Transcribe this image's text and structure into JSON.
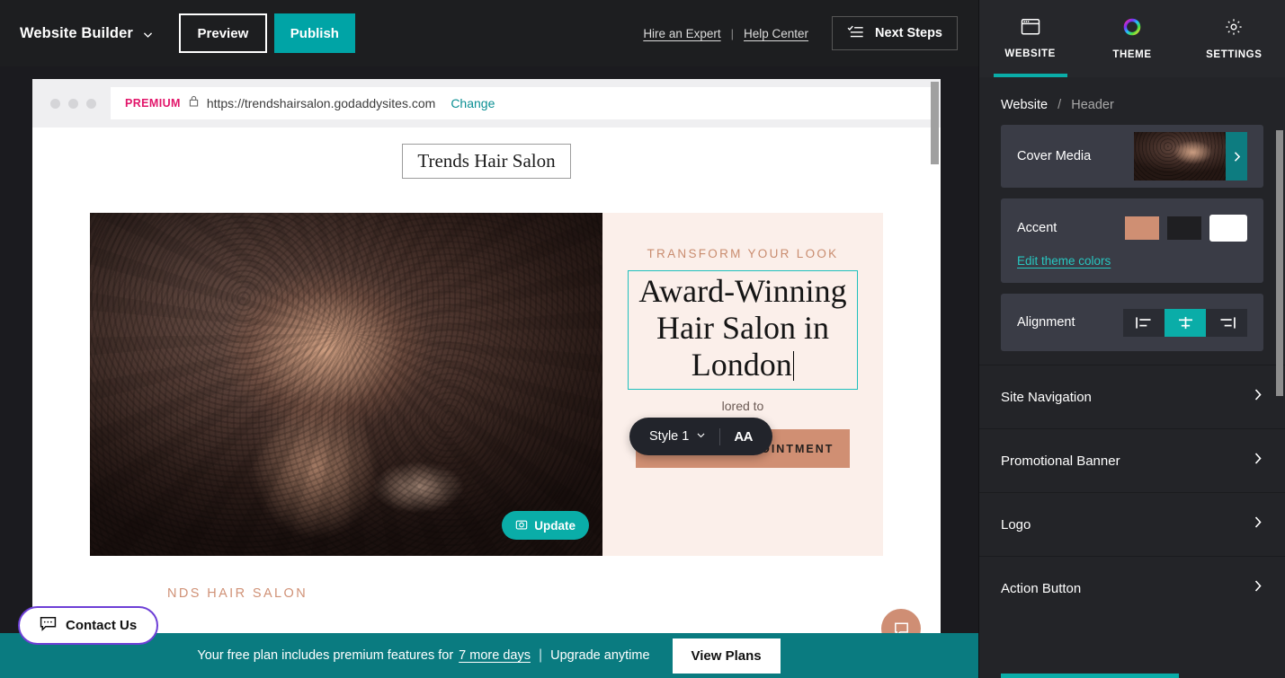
{
  "topbar": {
    "brand": "Website Builder",
    "brand_icon": "chevron-down-icon",
    "preview_label": "Preview",
    "publish_label": "Publish",
    "hire_expert": "Hire an Expert",
    "separator": "|",
    "help_center": "Help Center",
    "next_steps": "Next Steps",
    "next_steps_icon": "checklist-icon"
  },
  "browser": {
    "premium_tag": "PREMIUM",
    "lock_icon": "lock-icon",
    "url": "https://trendshairsalon.godaddysites.com",
    "change_label": "Change"
  },
  "site": {
    "title": "Trends Hair Salon",
    "eyebrow": "TRANSFORM YOUR LOOK",
    "headline": "Award-Winning Hair Salon in London",
    "subtext": "lored to",
    "cta_label": "SCHEDULE APPOINTMENT",
    "below_hero": "NDS HAIR SALON",
    "update_label": "Update",
    "update_icon": "camera-icon",
    "chat_icon": "chat-bubble-icon"
  },
  "style_toolbar": {
    "style_label": "Style 1",
    "chevron_icon": "chevron-down-icon",
    "font_size_label": "AA"
  },
  "contact_widget": {
    "label": "Contact Us",
    "icon": "chat-box-icon"
  },
  "bottom_banner": {
    "text_before": "Your free plan includes premium features for",
    "days_link": "7 more days",
    "pipe": "|",
    "text_after": "Upgrade anytime",
    "button": "View Plans"
  },
  "panel": {
    "tabs": [
      {
        "label": "WEBSITE",
        "icon": "browser-window-icon",
        "active": true
      },
      {
        "label": "THEME",
        "icon": "color-wheel-icon",
        "active": false
      },
      {
        "label": "SETTINGS",
        "icon": "gear-icon",
        "active": false
      }
    ],
    "breadcrumb": {
      "root": "Website",
      "separator": "/",
      "current": "Header"
    },
    "cover_media": {
      "label": "Cover Media",
      "arrow_icon": "chevron-right-icon"
    },
    "accent": {
      "label": "Accent",
      "swatches": [
        {
          "name": "salmon",
          "color": "#cf8f73",
          "selected": false
        },
        {
          "name": "dark",
          "color": "#1f1f22",
          "selected": false
        },
        {
          "name": "white",
          "color": "#ffffff",
          "selected": true
        }
      ],
      "edit_link": "Edit theme colors"
    },
    "alignment": {
      "label": "Alignment",
      "options": [
        {
          "name": "align-left",
          "selected": false
        },
        {
          "name": "align-center",
          "selected": true
        },
        {
          "name": "align-right",
          "selected": false
        }
      ]
    },
    "sections": [
      {
        "label": "Site Navigation",
        "icon": "chevron-right-icon"
      },
      {
        "label": "Promotional Banner",
        "icon": "chevron-right-icon"
      },
      {
        "label": "Logo",
        "icon": "chevron-right-icon"
      },
      {
        "label": "Action Button",
        "icon": "chevron-right-icon"
      }
    ]
  },
  "colors": {
    "teal": "#0aada8",
    "banner_teal": "#0a7b80",
    "accent_salmon": "#cf8f73",
    "premium_pink": "#e2156a",
    "panel_bg": "#232428",
    "card_bg": "#3a3c46"
  }
}
